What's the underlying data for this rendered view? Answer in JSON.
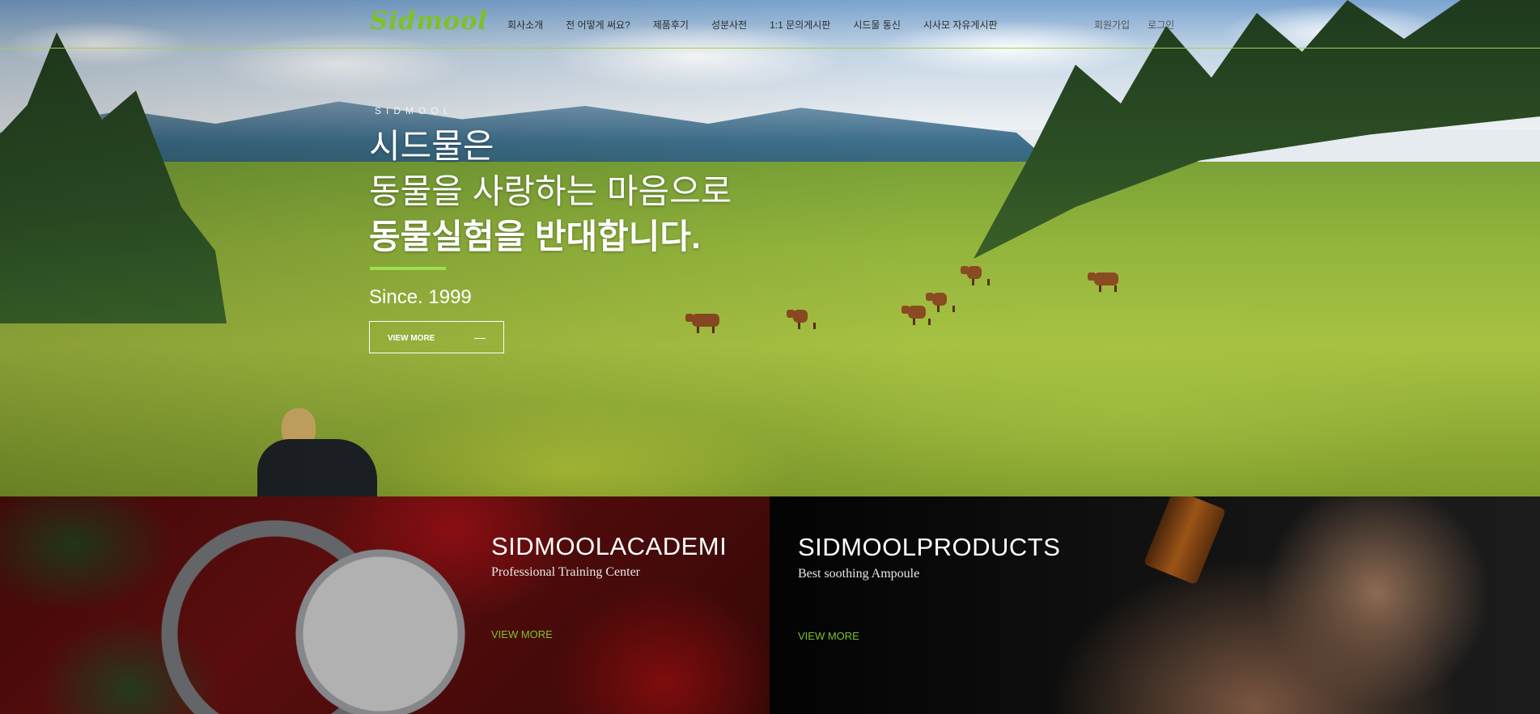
{
  "header": {
    "logo": "Sidmool",
    "nav": [
      "회사소개",
      "전 어떻게 써요?",
      "제품후기",
      "성분사전",
      "1:1 문의게시판",
      "시드물 통신",
      "시사모 자유게시판"
    ],
    "util": [
      "회원가입",
      "로그인"
    ]
  },
  "hero": {
    "brand": "SIDMOOL",
    "line1": "시드물은",
    "line2": "동물을 사랑하는 마음으로",
    "line3": "동물실험을 반대합니다.",
    "since": "Since. 1999",
    "button": "VIEW MORE"
  },
  "panels": {
    "academi": {
      "title": "SIDMOOLACADEMI",
      "subtitle": "Professional Training Center",
      "link": "VIEW MORE"
    },
    "products": {
      "title": "SIDMOOLPRODUCTS",
      "subtitle": "Best soothing Ampoule",
      "link": "VIEW MORE"
    }
  },
  "colors": {
    "accent": "#7cc12b",
    "header_line": "#9fd24a"
  }
}
